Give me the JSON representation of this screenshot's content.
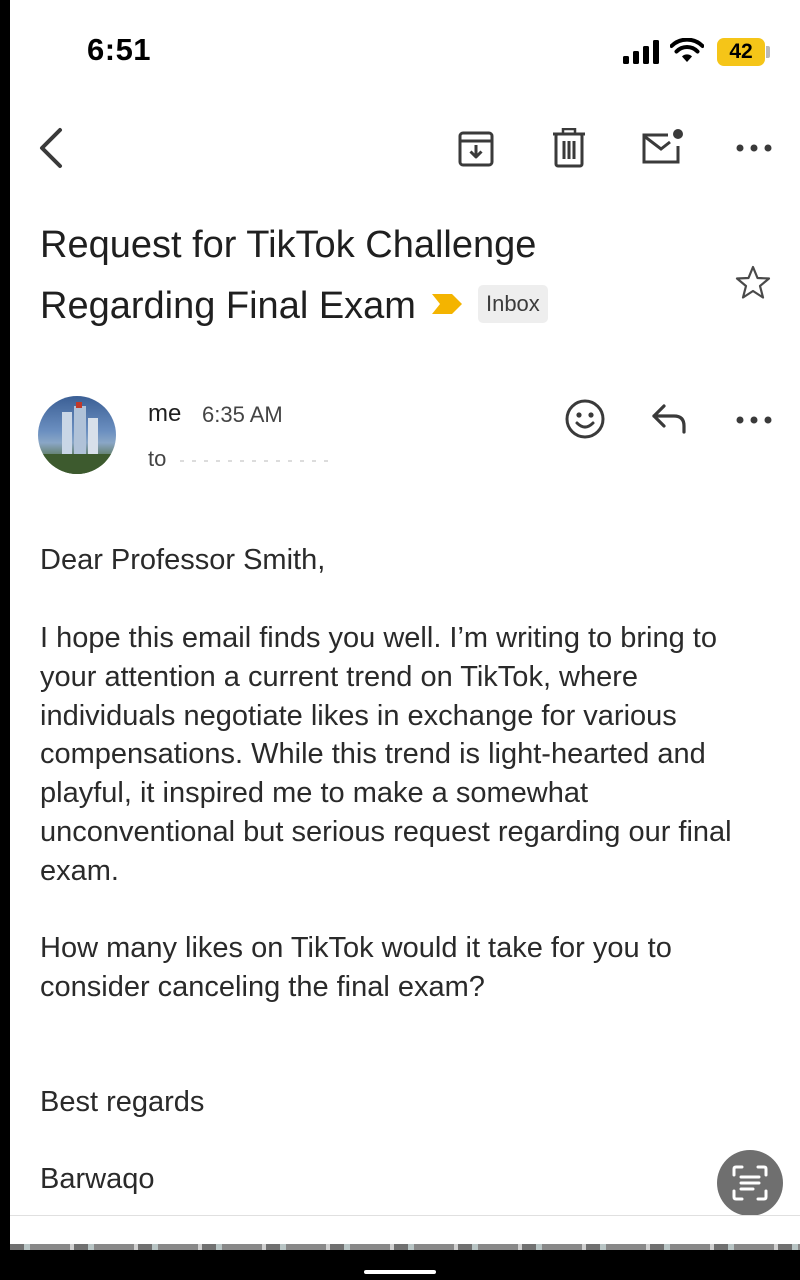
{
  "status_bar": {
    "time": "6:51",
    "battery": "42",
    "battery_color": "#f5c518"
  },
  "toolbar": {
    "back_icon": "chevron-left-icon",
    "archive_icon": "archive-icon",
    "delete_icon": "trash-icon",
    "mark_unread_icon": "mail-unread-icon",
    "more_icon": "more-horizontal-icon"
  },
  "email": {
    "subject": "Request for TikTok Challenge Regarding Final Exam",
    "label": "Inbox",
    "importance_color": "#f4b400"
  },
  "message": {
    "sender": "me",
    "time": "6:35 AM",
    "to_label": "to",
    "greeting": "Dear Professor Smith,",
    "paragraph1": "I hope this email finds you well. I’m writing to bring to your attention a current trend on TikTok, where individuals negotiate likes in exchange for various compensations. While this trend is light-hearted and playful, it inspired me to make a somewhat unconventional but serious request regarding our final exam.",
    "paragraph2": "How many likes on TikTok would it take for you to consider canceling the final exam?",
    "signoff": "Best regards",
    "signature": "Barwaqo"
  }
}
